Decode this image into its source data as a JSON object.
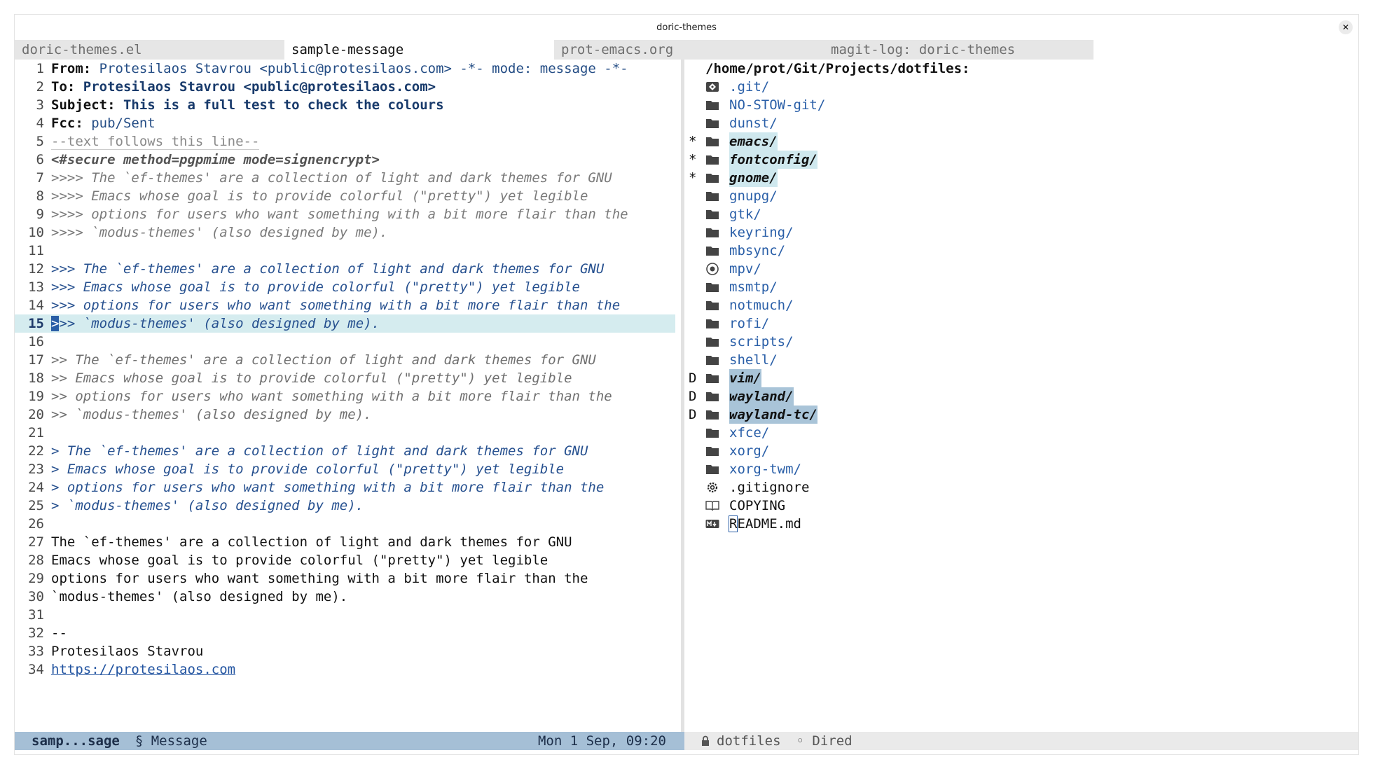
{
  "window": {
    "title": "doric-themes",
    "close_glyph": "✕"
  },
  "tabs": [
    {
      "label": "doric-themes.el"
    },
    {
      "label": "sample-message"
    },
    {
      "label": "prot-emacs.org"
    },
    {
      "label": "magit-log: doric-themes"
    }
  ],
  "colors": {
    "accent_blue": "#2a5fa8",
    "modeline_active_bg": "#a5bfd6",
    "current_line_bg": "#d5ecef",
    "dired_marked_bg": "#cfe8ee",
    "dired_flagged_bg": "#a9c4d8"
  },
  "message": {
    "lines": [
      {
        "num": "1",
        "key": "From:",
        "val": " Protesilaos Stavrou <public@protesilaos.com> -*- mode: message -*-"
      },
      {
        "num": "2",
        "key": "To:",
        "val": " Protesilaos Stavrou <public@protesilaos.com>"
      },
      {
        "num": "3",
        "key": "Subject:",
        "val": " This is a full test to check the colours"
      },
      {
        "num": "4",
        "key": "Fcc:",
        "val": " pub/Sent"
      },
      {
        "num": "5",
        "text": "--text follows this line--"
      },
      {
        "num": "6",
        "text": "<#secure method=pgpmime mode=signencrypt>"
      },
      {
        "num": "7",
        "text": ">>>> The `ef-themes' are a collection of light and dark themes for GNU"
      },
      {
        "num": "8",
        "text": ">>>> Emacs whose goal is to provide colorful (\"pretty\") yet legible"
      },
      {
        "num": "9",
        "text": ">>>> options for users who want something with a bit more flair than the"
      },
      {
        "num": "10",
        "text": ">>>> `modus-themes' (also designed by me)."
      },
      {
        "num": "11",
        "text": ""
      },
      {
        "num": "12",
        "text": ">>> The `ef-themes' are a collection of light and dark themes for GNU"
      },
      {
        "num": "13",
        "text": ">>> Emacs whose goal is to provide colorful (\"pretty\") yet legible"
      },
      {
        "num": "14",
        "text": ">>> options for users who want something with a bit more flair than the"
      },
      {
        "num": "15",
        "cursor": ">",
        "text": ">> `modus-themes' (also designed by me)."
      },
      {
        "num": "16",
        "text": ""
      },
      {
        "num": "17",
        "text": ">> The `ef-themes' are a collection of light and dark themes for GNU"
      },
      {
        "num": "18",
        "text": ">> Emacs whose goal is to provide colorful (\"pretty\") yet legible"
      },
      {
        "num": "19",
        "text": ">> options for users who want something with a bit more flair than the"
      },
      {
        "num": "20",
        "text": ">> `modus-themes' (also designed by me)."
      },
      {
        "num": "21",
        "text": ""
      },
      {
        "num": "22",
        "text": "> The `ef-themes' are a collection of light and dark themes for GNU"
      },
      {
        "num": "23",
        "text": "> Emacs whose goal is to provide colorful (\"pretty\") yet legible"
      },
      {
        "num": "24",
        "text": "> options for users who want something with a bit more flair than the"
      },
      {
        "num": "25",
        "text": "> `modus-themes' (also designed by me)."
      },
      {
        "num": "26",
        "text": ""
      },
      {
        "num": "27",
        "text": "The `ef-themes' are a collection of light and dark themes for GNU"
      },
      {
        "num": "28",
        "text": "Emacs whose goal is to provide colorful (\"pretty\") yet legible"
      },
      {
        "num": "29",
        "text": "options for users who want something with a bit more flair than the"
      },
      {
        "num": "30",
        "text": "`modus-themes' (also designed by me)."
      },
      {
        "num": "31",
        "text": ""
      },
      {
        "num": "32",
        "text": "--"
      },
      {
        "num": "33",
        "text": "Protesilaos Stavrou"
      },
      {
        "num": "34",
        "text": "https://protesilaos.com"
      }
    ]
  },
  "dired": {
    "header": "/home/prot/Git/Projects/dotfiles:",
    "entries": [
      {
        "mark": "",
        "icon": "git-icon",
        "name": ".git/"
      },
      {
        "mark": "",
        "icon": "folder-icon",
        "name": "NO-STOW-git/"
      },
      {
        "mark": "",
        "icon": "folder-icon",
        "name": "dunst/"
      },
      {
        "mark": "*",
        "icon": "folder-icon",
        "name": "emacs/"
      },
      {
        "mark": "*",
        "icon": "folder-icon",
        "name": "fontconfig/"
      },
      {
        "mark": "*",
        "icon": "folder-icon",
        "name": "gnome/"
      },
      {
        "mark": "",
        "icon": "folder-icon",
        "name": "gnupg/"
      },
      {
        "mark": "",
        "icon": "folder-icon",
        "name": "gtk/"
      },
      {
        "mark": "",
        "icon": "folder-icon",
        "name": "keyring/"
      },
      {
        "mark": "",
        "icon": "folder-icon",
        "name": "mbsync/"
      },
      {
        "mark": "",
        "icon": "disc-icon",
        "name": "mpv/"
      },
      {
        "mark": "",
        "icon": "folder-icon",
        "name": "msmtp/"
      },
      {
        "mark": "",
        "icon": "folder-icon",
        "name": "notmuch/"
      },
      {
        "mark": "",
        "icon": "folder-icon",
        "name": "rofi/"
      },
      {
        "mark": "",
        "icon": "folder-icon",
        "name": "scripts/"
      },
      {
        "mark": "",
        "icon": "folder-icon",
        "name": "shell/"
      },
      {
        "mark": "D",
        "icon": "folder-icon",
        "name": "vim/"
      },
      {
        "mark": "D",
        "icon": "folder-icon",
        "name": "wayland/"
      },
      {
        "mark": "D",
        "icon": "folder-icon",
        "name": "wayland-tc/"
      },
      {
        "mark": "",
        "icon": "folder-icon",
        "name": "xfce/"
      },
      {
        "mark": "",
        "icon": "folder-icon",
        "name": "xorg/"
      },
      {
        "mark": "",
        "icon": "folder-icon",
        "name": "xorg-twm/"
      },
      {
        "mark": "",
        "icon": "gear-icon",
        "name": ".gitignore"
      },
      {
        "mark": "",
        "icon": "book-icon",
        "name": "COPYING"
      },
      {
        "mark": "",
        "icon": "markdown-icon",
        "name": "README.md",
        "cursor": "R",
        "rest": "EADME.md"
      }
    ]
  },
  "modeline_left": {
    "buffer": "samp...sage",
    "mode": "§ Message",
    "time": "Mon  1 Sep, 09:20"
  },
  "modeline_right": {
    "buffer": "dotfiles",
    "mode": "◦ Dired"
  }
}
